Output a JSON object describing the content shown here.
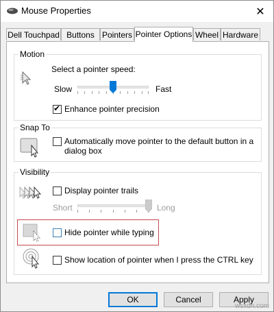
{
  "window": {
    "title": "Mouse Properties",
    "close_glyph": "✕"
  },
  "tabs": [
    {
      "label": "Dell Touchpad"
    },
    {
      "label": "Buttons"
    },
    {
      "label": "Pointers"
    },
    {
      "label": "Pointer Options",
      "active": true
    },
    {
      "label": "Wheel"
    },
    {
      "label": "Hardware"
    }
  ],
  "motion": {
    "group_label": "Motion",
    "speed_label": "Select a pointer speed:",
    "slow_label": "Slow",
    "fast_label": "Fast",
    "speed_level": 0.5,
    "enhance_label": "Enhance pointer precision",
    "enhance_checked": true
  },
  "snap_to": {
    "group_label": "Snap To",
    "checkbox_label_line1": "Automatically move pointer to the default button in a",
    "checkbox_label_line2": "dialog box",
    "checked": false
  },
  "visibility": {
    "group_label": "Visibility",
    "trails_label": "Display pointer trails",
    "trails_checked": false,
    "short_label": "Short",
    "long_label": "Long",
    "trails_level": 1.0,
    "hide_label": "Hide pointer while typing",
    "hide_checked": false,
    "ctrl_label": "Show location of pointer when I press the CTRL key",
    "ctrl_checked": false
  },
  "buttons": {
    "ok": "OK",
    "cancel": "Cancel",
    "apply": "Apply"
  },
  "watermark": "wsxdn.com",
  "colors": {
    "accent": "#0078d7",
    "highlight": "#c14a4a"
  }
}
